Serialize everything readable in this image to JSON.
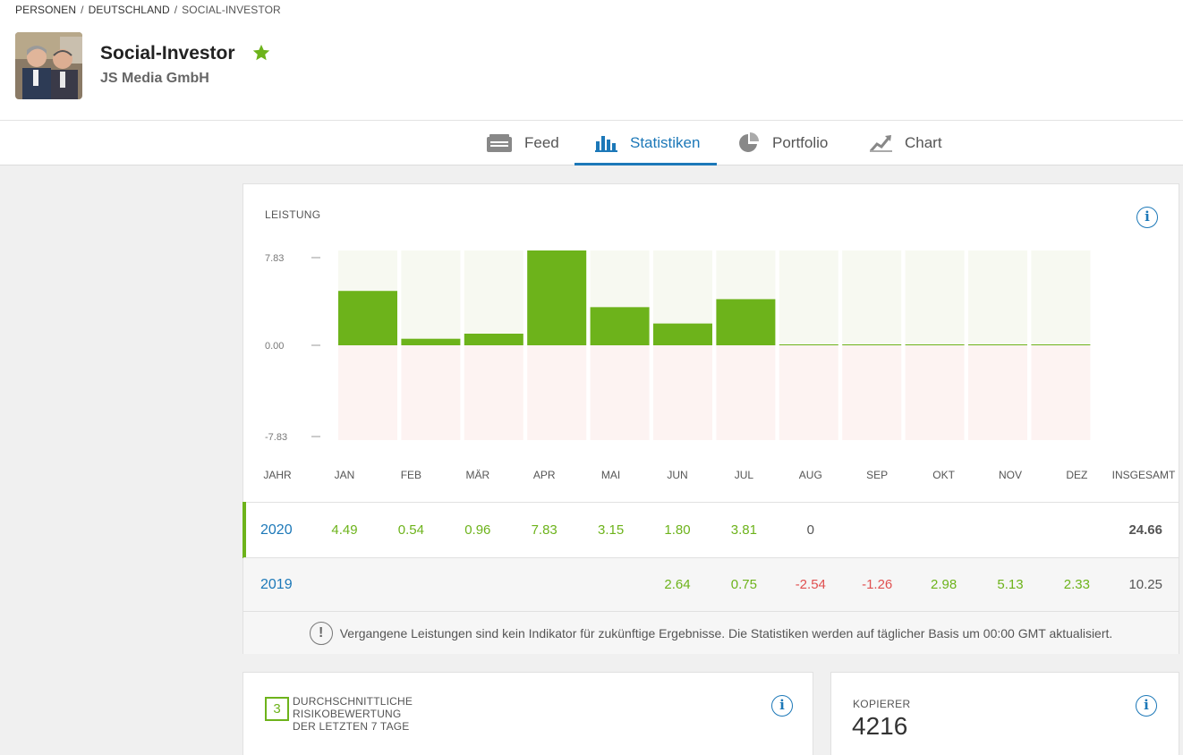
{
  "breadcrumb": {
    "items": [
      "PERSONEN",
      "DEUTSCHLAND",
      "SOCIAL-INVESTOR"
    ],
    "separator": "/"
  },
  "profile": {
    "username": "Social-Investor",
    "full_name": "JS Media GmbH",
    "star_icon": "star-icon",
    "star_color": "#6db31b"
  },
  "tabs": [
    {
      "label": "Feed",
      "icon": "feed-icon",
      "active": false
    },
    {
      "label": "Statistiken",
      "icon": "bar-chart-icon",
      "active": true
    },
    {
      "label": "Portfolio",
      "icon": "pie-chart-icon",
      "active": false
    },
    {
      "label": "Chart",
      "icon": "line-chart-icon",
      "active": false
    }
  ],
  "performance": {
    "section_label": "LEISTUNG",
    "info_icon": "i",
    "columns_header": {
      "year": "JAHR",
      "months": [
        "JAN",
        "FEB",
        "MÄR",
        "APR",
        "MAI",
        "JUN",
        "JUL",
        "AUG",
        "SEP",
        "OKT",
        "NOV",
        "DEZ"
      ],
      "total": "INSGESAMT"
    },
    "rows": [
      {
        "year": "2020",
        "values": [
          "4.49",
          "0.54",
          "0.96",
          "7.83",
          "3.15",
          "1.80",
          "3.81",
          "0",
          "",
          "",
          "",
          ""
        ],
        "total": "24.66"
      },
      {
        "year": "2019",
        "values": [
          "",
          "",
          "",
          "",
          "",
          "2.64",
          "0.75",
          "-2.54",
          "-1.26",
          "2.98",
          "5.13",
          "2.33"
        ],
        "total": "10.25"
      }
    ],
    "disclaimer": "Vergangene Leistungen sind kein Indikator für zukünftige Ergebnisse. Die Statistiken werden auf täglicher Basis um 00:00 GMT aktualisiert.",
    "disclaimer_icon": "!"
  },
  "chart_data": {
    "type": "bar",
    "categories": [
      "JAN",
      "FEB",
      "MÄR",
      "APR",
      "MAI",
      "JUN",
      "JUL",
      "AUG",
      "SEP",
      "OKT",
      "NOV",
      "DEZ"
    ],
    "values": [
      4.49,
      0.54,
      0.96,
      7.83,
      3.15,
      1.8,
      3.81,
      0,
      0,
      0,
      0,
      0
    ],
    "ylim": [
      -7.83,
      7.83
    ],
    "yticks": [
      "7.83",
      "0.00",
      "-7.83"
    ],
    "title": "",
    "xlabel": "",
    "ylabel": "",
    "bar_color": "#6db31b",
    "positive_bg": "#f7f9f1",
    "negative_bg": "#fdf3f2"
  },
  "risk": {
    "score": "3",
    "label_lines": [
      "DURCHSCHNITTLICHE",
      "RISIKOBEWERTUNG",
      "DER LETZTEN 7 TAGE"
    ],
    "info_icon": "i"
  },
  "copiers": {
    "label": "KOPIERER",
    "value": "4216",
    "info_icon": "i"
  },
  "colors": {
    "accent": "#1c78b8",
    "positive": "#6db31b",
    "negative": "#e05050"
  }
}
